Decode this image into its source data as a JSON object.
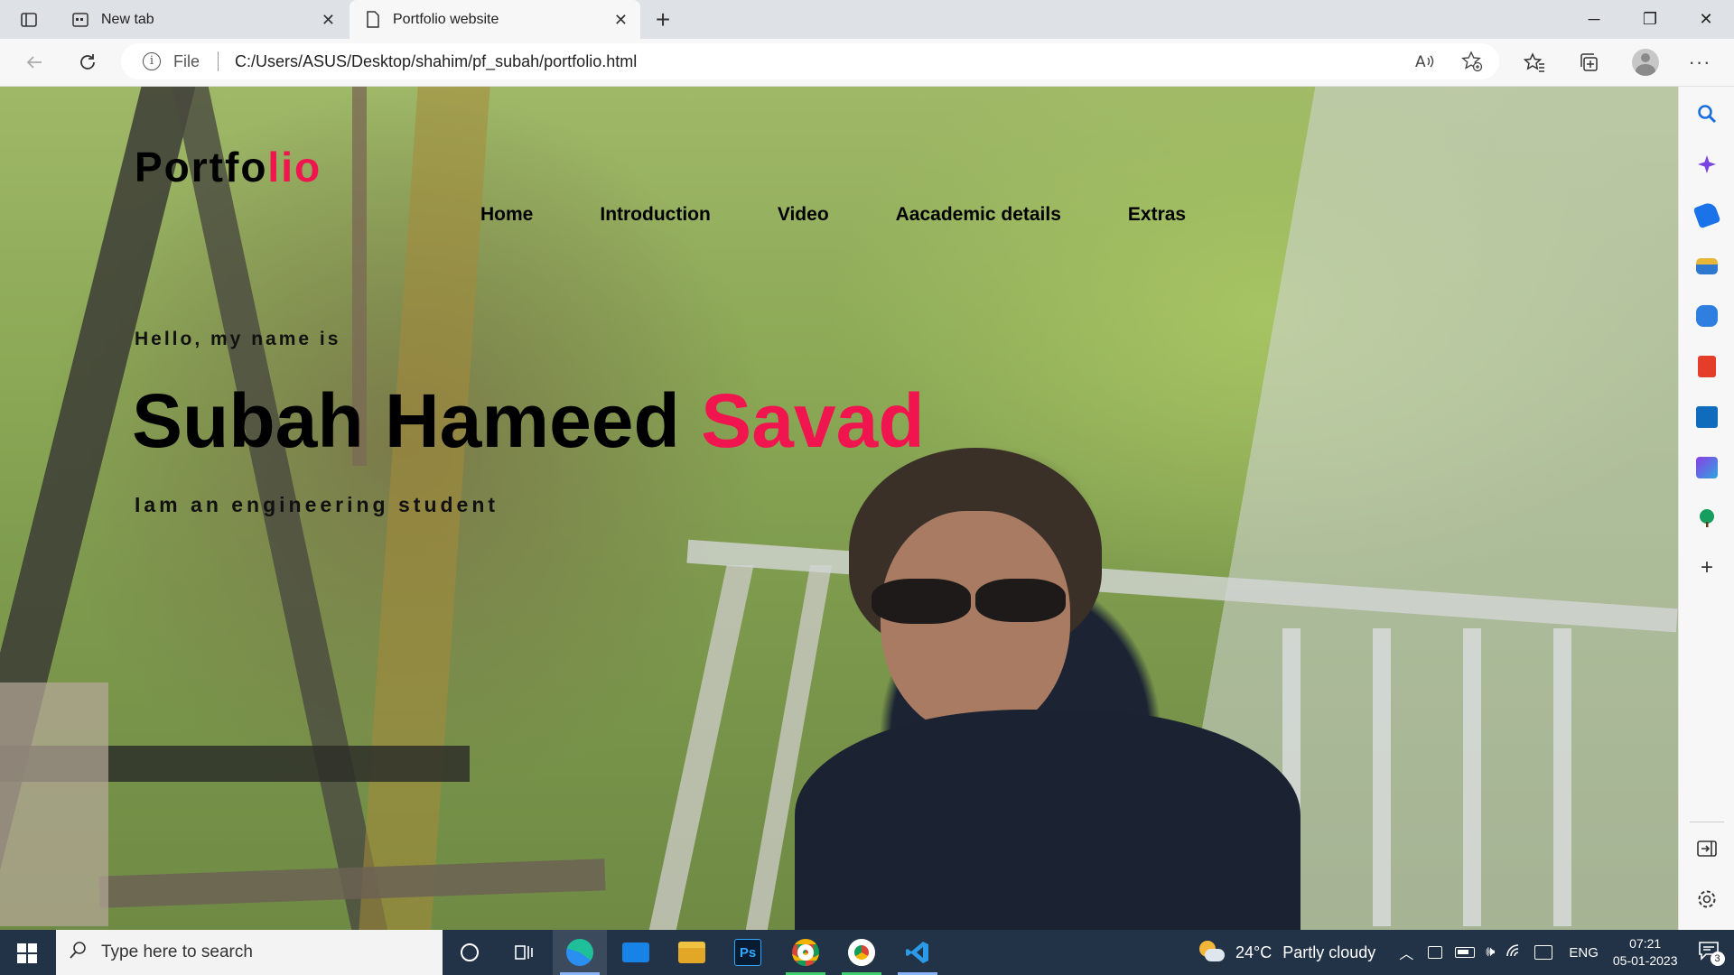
{
  "browser": {
    "tabs": [
      {
        "label": "New tab",
        "close": "✕"
      },
      {
        "label": "Portfolio website",
        "close": "✕"
      }
    ],
    "new_tab_symbol": "+",
    "window_controls": {
      "minimize": "─",
      "restore": "❐",
      "close": "✕"
    },
    "address": {
      "scheme_label": "File",
      "url": "C:/Users/ASUS/Desktop/shahim/pf_subah/portfolio.html"
    },
    "icons": [
      "tab-actions-icon",
      "back-icon",
      "refresh-icon",
      "info-icon",
      "read-aloud-icon",
      "add-favorite-icon",
      "favorites-icon",
      "collections-icon",
      "profile-icon",
      "more-icon"
    ]
  },
  "page": {
    "logo": {
      "part1": "Portfo",
      "part2": "lio"
    },
    "nav": [
      "Home",
      "Introduction",
      "Video",
      "Aacademic details",
      "Extras"
    ],
    "hero": {
      "greeting": "Hello, my name is",
      "name_main": "Subah Hameed ",
      "name_accent": "Savad",
      "tagline": "Iam an engineering student"
    },
    "accent_color": "#f0154e"
  },
  "sidebar": {
    "icons": [
      "search-icon",
      "copilot-icon",
      "shopping-icon",
      "tools-icon",
      "games-icon",
      "office-icon",
      "outlook-icon",
      "designer-icon",
      "tree-icon",
      "add-icon",
      "split-screen-icon",
      "settings-icon"
    ]
  },
  "taskbar": {
    "search_placeholder": "Type here to search",
    "apps": [
      "cortana-icon",
      "task-view-icon",
      "edge-icon",
      "mail-icon",
      "file-explorer-icon",
      "photoshop-icon",
      "chrome-icon",
      "chrome-icon",
      "vscode-icon"
    ],
    "photoshop_label": "Ps",
    "weather": {
      "temp": "24°C",
      "condition": "Partly cloudy"
    },
    "language": "ENG",
    "time": "07:21",
    "date": "05-01-2023",
    "notification_count": "3"
  }
}
